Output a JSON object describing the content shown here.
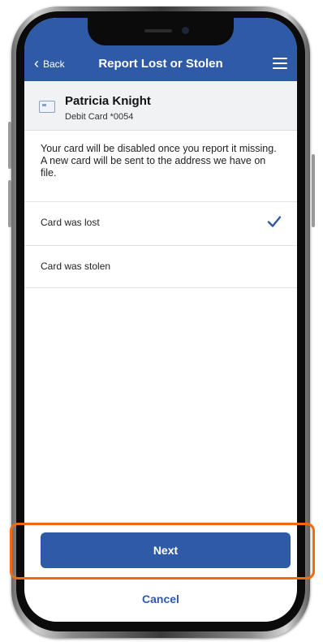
{
  "colors": {
    "header_bg": "#2f5aa8",
    "primary": "#2f5aa8",
    "check": "#2f5aa8",
    "highlight": "#f26a10",
    "page_bg": "#ffffff"
  },
  "header": {
    "back_label": "Back",
    "back_icon": "chevron-left-icon",
    "title": "Report Lost or Stolen",
    "menu_icon": "hamburger-menu-icon"
  },
  "card": {
    "icon": "credit-card-icon",
    "name": "Patricia Knight",
    "number": "Debit Card *0054"
  },
  "info_text": "Your card will be disabled once you report it missing. A new card will be sent to the address we have on file.",
  "options": [
    {
      "label": "Card was lost",
      "selected": true
    },
    {
      "label": "Card was stolen",
      "selected": false
    }
  ],
  "actions": {
    "next_label": "Next",
    "cancel_label": "Cancel"
  }
}
